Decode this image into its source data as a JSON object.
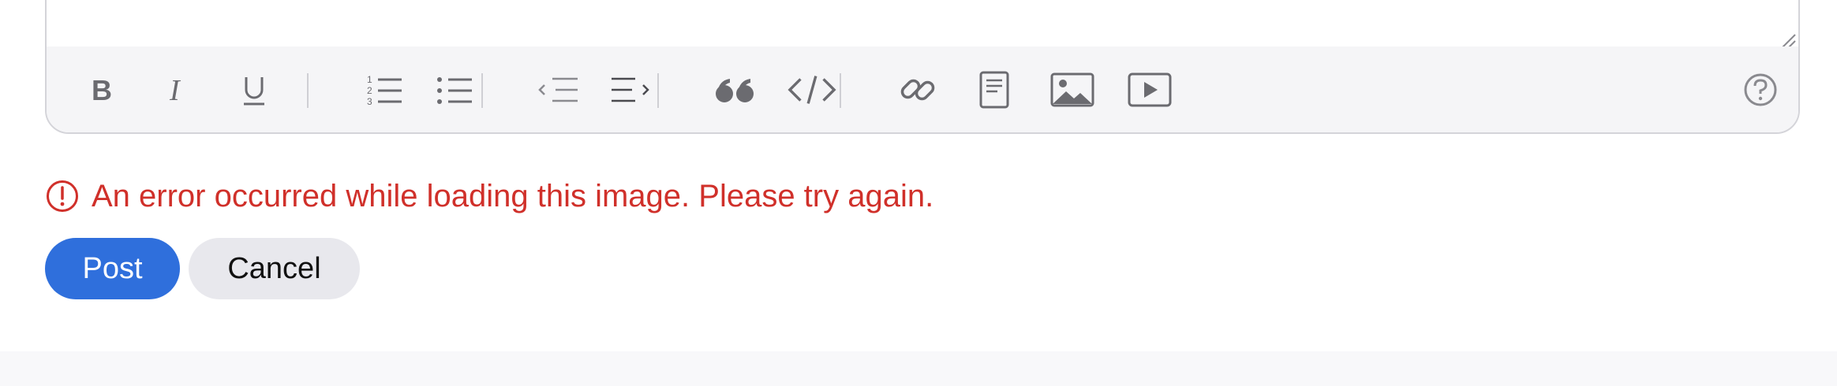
{
  "editor": {
    "toolbar": {
      "tools": [
        {
          "icon": "bold-icon"
        },
        {
          "icon": "italic-icon"
        },
        {
          "icon": "underline-icon"
        },
        {
          "icon": "numbered-list-icon"
        },
        {
          "icon": "bulleted-list-icon"
        },
        {
          "icon": "outdent-icon"
        },
        {
          "icon": "indent-icon"
        },
        {
          "icon": "quote-icon"
        },
        {
          "icon": "code-icon"
        },
        {
          "icon": "link-icon"
        },
        {
          "icon": "document-icon"
        },
        {
          "icon": "image-icon"
        },
        {
          "icon": "video-icon"
        },
        {
          "icon": "help-icon"
        }
      ]
    }
  },
  "error": {
    "message": "An error occurred while loading this image. Please try again.",
    "icon": "error-circle-icon",
    "color": "#d0302a"
  },
  "actions": {
    "post_label": "Post",
    "cancel_label": "Cancel",
    "post_color": "#2f6fdc"
  }
}
